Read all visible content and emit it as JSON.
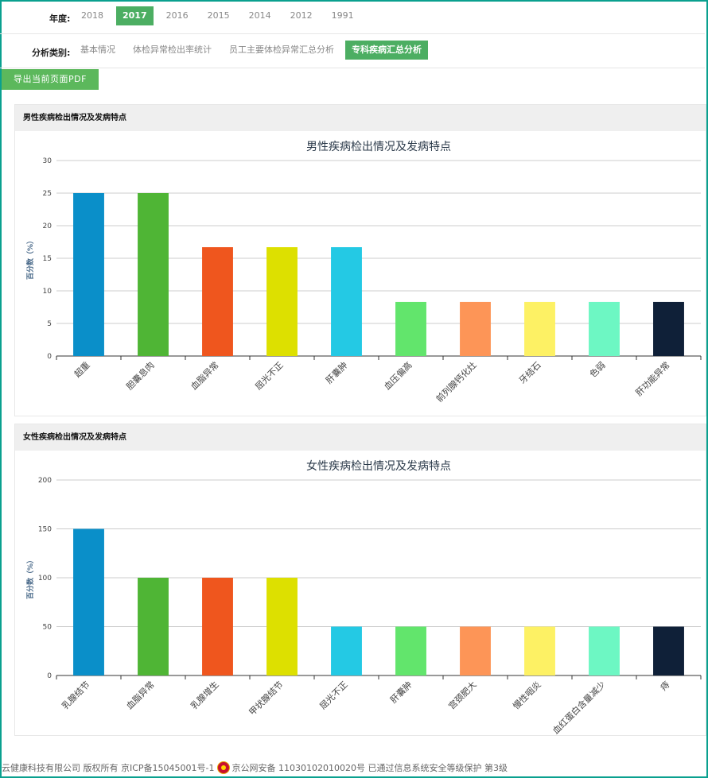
{
  "filters": {
    "year_label": "年度:",
    "years": [
      "2018",
      "2017",
      "2016",
      "2015",
      "2014",
      "2012",
      "1991"
    ],
    "selected_year": "2017",
    "type_label": "分析类别:",
    "types": [
      "基本情况",
      "体检异常检出率统计",
      "员工主要体检异常汇总分析",
      "专科疾病汇总分析"
    ],
    "selected_type": "专科疾病汇总分析"
  },
  "export_button": "导出当前页面PDF",
  "panels": [
    {
      "header": "男性疾病检出情况及发病特点"
    },
    {
      "header": "女性疾病检出情况及发病特点"
    }
  ],
  "footer": {
    "text_left": "云健康科技有限公司 版权所有 京ICP备15045001号-1",
    "text_right": "京公网安备 11030102010020号 已通过信息系统安全等级保护 第3级"
  },
  "colors": [
    "#0a8fc9",
    "#4fb535",
    "#ef561e",
    "#dde000",
    "#24c9e4",
    "#62e56c",
    "#fd9557",
    "#fdf164",
    "#6df7c3",
    "#0f2038"
  ],
  "chart_data": [
    {
      "type": "bar",
      "title": "男性疾病检出情况及发病特点",
      "ylabel": "百分数（%）",
      "xlabel": "",
      "ylim": [
        0,
        30
      ],
      "yticks": [
        0,
        5,
        10,
        15,
        20,
        25,
        30
      ],
      "grid": true,
      "categories": [
        "超重",
        "胆囊息肉",
        "血脂异常",
        "屈光不正",
        "肝囊肿",
        "血压偏高",
        "前列腺钙化灶",
        "牙结石",
        "色弱",
        "肝功能异常"
      ],
      "values": [
        25,
        25,
        16.7,
        16.7,
        16.7,
        8.3,
        8.3,
        8.3,
        8.3,
        8.3
      ]
    },
    {
      "type": "bar",
      "title": "女性疾病检出情况及发病特点",
      "ylabel": "百分数（%）",
      "xlabel": "",
      "ylim": [
        0,
        200
      ],
      "yticks": [
        0,
        50,
        100,
        150,
        200
      ],
      "grid": true,
      "categories": [
        "乳腺结节",
        "血脂异常",
        "乳腺增生",
        "甲状腺结节",
        "屈光不正",
        "肝囊肿",
        "宫颈肥大",
        "慢性咽炎",
        "血红蛋白含量减少",
        "痔"
      ],
      "values": [
        150,
        100,
        100,
        100,
        50,
        50,
        50,
        50,
        50,
        50
      ]
    }
  ]
}
